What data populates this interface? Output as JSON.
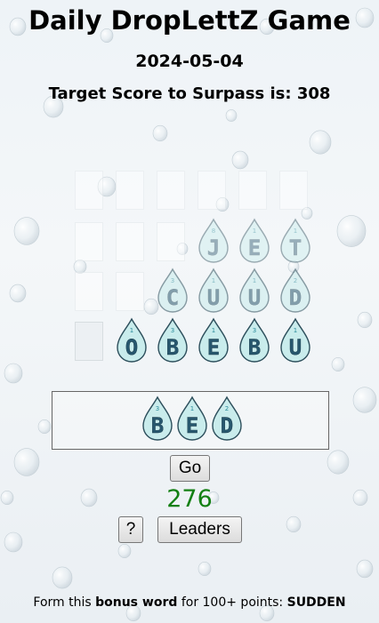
{
  "header": {
    "title": "Daily DropLettZ Game",
    "date": "2024-05-04",
    "target_label": "Target Score to Surpass is: 308"
  },
  "board": {
    "rows": [
      {
        "cells": [
          {
            "letter": "",
            "points": ""
          },
          {
            "letter": "",
            "points": ""
          },
          {
            "letter": "",
            "points": ""
          },
          {
            "letter": "",
            "points": ""
          },
          {
            "letter": "",
            "points": ""
          },
          {
            "letter": "",
            "points": ""
          }
        ]
      },
      {
        "cells": [
          {
            "letter": "",
            "points": ""
          },
          {
            "letter": "",
            "points": ""
          },
          {
            "letter": "",
            "points": ""
          },
          {
            "letter": "J",
            "points": "8"
          },
          {
            "letter": "E",
            "points": "1"
          },
          {
            "letter": "T",
            "points": "1"
          }
        ]
      },
      {
        "cells": [
          {
            "letter": "",
            "points": ""
          },
          {
            "letter": "",
            "points": ""
          },
          {
            "letter": "C",
            "points": "3"
          },
          {
            "letter": "U",
            "points": "1"
          },
          {
            "letter": "U",
            "points": "1"
          },
          {
            "letter": "D",
            "points": "2"
          }
        ]
      },
      {
        "cells": [
          {
            "letter": "",
            "points": ""
          },
          {
            "letter": "O",
            "points": "1"
          },
          {
            "letter": "B",
            "points": "3"
          },
          {
            "letter": "E",
            "points": "1"
          },
          {
            "letter": "B",
            "points": "3"
          },
          {
            "letter": "U",
            "points": "1"
          }
        ]
      }
    ]
  },
  "current_word": [
    {
      "letter": "B",
      "points": "3"
    },
    {
      "letter": "E",
      "points": "1"
    },
    {
      "letter": "D",
      "points": "2"
    }
  ],
  "controls": {
    "go_label": "Go",
    "help_label": "?",
    "leaders_label": "Leaders"
  },
  "score": "276",
  "bonus": {
    "prefix": "Form this",
    "bold": "bonus word",
    "suffix": "for 100+ points:",
    "word": "SUDDEN"
  },
  "colors": {
    "drop_fill": "#c9ecec",
    "drop_fill_faded": "#dff2f2",
    "letter": "#27576e",
    "score": "#138013"
  }
}
